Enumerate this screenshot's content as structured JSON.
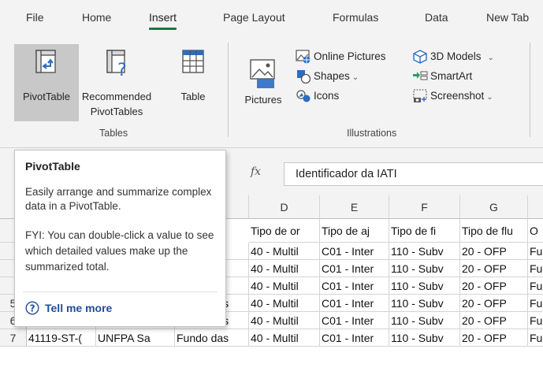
{
  "ribbon_tabs": [
    "File",
    "Home",
    "Insert",
    "Page Layout",
    "Formulas",
    "Data",
    "New Tab"
  ],
  "active_tab": "Insert",
  "tables_group": {
    "label": "Tables",
    "pivot_table": "PivotTable",
    "recommended_line1": "Recommended",
    "recommended_line2": "PivotTables",
    "table": "Table"
  },
  "illustrations_group": {
    "label": "Illustrations",
    "pictures": "Pictures",
    "online_pictures": "Online Pictures",
    "shapes": "Shapes",
    "icons": "Icons",
    "models_3d": "3D Models",
    "smartart": "SmartArt",
    "screenshot": "Screenshot"
  },
  "formula_bar": {
    "fx": "fx",
    "content": "Identificador da IATI"
  },
  "columns": [
    "D",
    "E",
    "F",
    "G"
  ],
  "header_row": [
    "Tipo de or",
    "Tipo de aj",
    "Tipo de fi",
    "Tipo de flu",
    "O"
  ],
  "rows": [
    {
      "num": "",
      "a": "",
      "b": "",
      "c": "",
      "d": "40 - Multil",
      "e": "C01 - Inter",
      "f": "110 - Subv",
      "g": "20 - OFP",
      "h": "Fu"
    },
    {
      "num": "",
      "a": "",
      "b": "",
      "c": "",
      "d": "40 - Multil",
      "e": "C01 - Inter",
      "f": "110 - Subv",
      "g": "20 - OFP",
      "h": "Fu"
    },
    {
      "num": "",
      "a": "",
      "b": "",
      "c": "",
      "d": "40 - Multil",
      "e": "C01 - Inter",
      "f": "110 - Subv",
      "g": "20 - OFP",
      "h": "Fu"
    },
    {
      "num": "5",
      "a": "41119-ST-",
      "b": "UNFPA Sa",
      "c": "Fundo das",
      "d": "40 - Multil",
      "e": "C01 - Inter",
      "f": "110 - Subv",
      "g": "20 - OFP",
      "h": "Fu"
    },
    {
      "num": "6",
      "a": "41119-ST-(",
      "b": "UNFPA Sa",
      "c": "Fundo das",
      "d": "40 - Multil",
      "e": "C01 - Inter",
      "f": "110 - Subv",
      "g": "20 - OFP",
      "h": "Fu"
    },
    {
      "num": "7",
      "a": "41119-ST-(",
      "b": "UNFPA Sa",
      "c": "Fundo das",
      "d": "40 - Multil",
      "e": "C01 - Inter",
      "f": "110 - Subv",
      "g": "20 - OFP",
      "h": "Fu"
    }
  ],
  "tooltip": {
    "title": "PivotTable",
    "description": "Easily arrange and summarize complex data in a PivotTable.",
    "fyi": "FYI: You can double-click a value to see which detailed values make up the summarized total.",
    "link": "Tell me more"
  },
  "colors": {
    "accent_green": "#217346",
    "link_blue": "#1f4e9c",
    "pressed_gray": "#c8c8c8"
  }
}
